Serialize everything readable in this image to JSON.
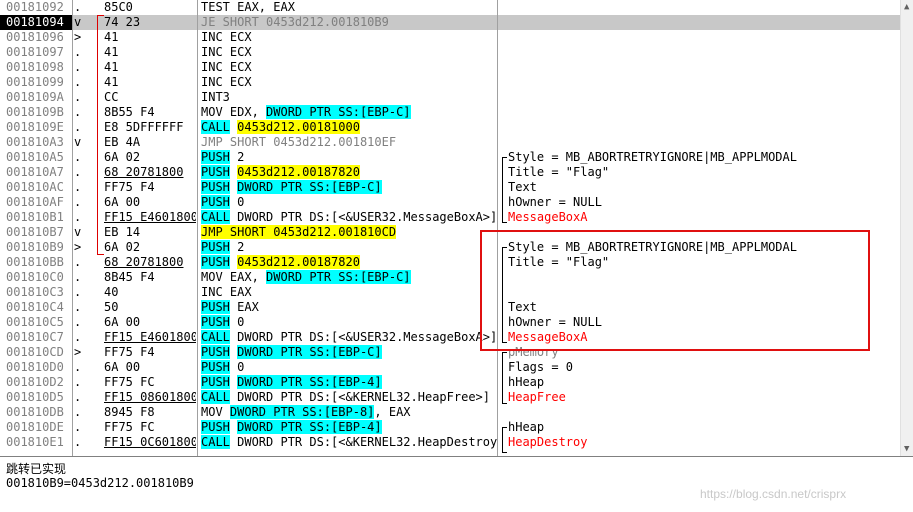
{
  "rows": [
    {
      "addr": "00181092",
      "mk": ".",
      "hex": "85C0",
      "dis": [
        {
          "t": "TEST EAX, EAX"
        }
      ],
      "cmt": []
    },
    {
      "addr": "00181094",
      "mk": "v",
      "hex": "74 23",
      "dis": [
        {
          "t": "JE SHORT 0453d212.001810B9",
          "c": "gray"
        }
      ],
      "cmt": [],
      "state": "cur"
    },
    {
      "addr": "00181096",
      "mk": ">",
      "hex": "41",
      "dis": [
        {
          "t": "INC ECX"
        }
      ],
      "cmt": []
    },
    {
      "addr": "00181097",
      "mk": ".",
      "hex": "41",
      "dis": [
        {
          "t": "INC ECX"
        }
      ],
      "cmt": []
    },
    {
      "addr": "00181098",
      "mk": ".",
      "hex": "41",
      "dis": [
        {
          "t": "INC ECX"
        }
      ],
      "cmt": []
    },
    {
      "addr": "00181099",
      "mk": ".",
      "hex": "41",
      "dis": [
        {
          "t": "INC ECX"
        }
      ],
      "cmt": []
    },
    {
      "addr": "0018109A",
      "mk": ".",
      "hex": "CC",
      "dis": [
        {
          "t": "INT3"
        }
      ],
      "cmt": []
    },
    {
      "addr": "0018109B",
      "mk": ".",
      "hex": "8B55 F4",
      "dis": [
        {
          "t": "MOV EDX, "
        },
        {
          "t": "DWORD PTR SS:[EBP-C]",
          "c": "cy"
        }
      ],
      "cmt": []
    },
    {
      "addr": "0018109E",
      "mk": ".",
      "hex": "E8 5DFFFFFF",
      "dis": [
        {
          "t": "CALL",
          "c": "cy"
        },
        {
          "t": " "
        },
        {
          "t": "0453d212.00181000",
          "c": "yl"
        }
      ],
      "cmt": []
    },
    {
      "addr": "001810A3",
      "mk": "v",
      "hex": "EB 4A",
      "dis": [
        {
          "t": "JMP SHORT 0453d212.001810EF",
          "c": "gray"
        }
      ],
      "cmt": []
    },
    {
      "addr": "001810A5",
      "mk": ".",
      "hex": "6A 02",
      "dis": [
        {
          "t": "PUSH",
          "c": "cy"
        },
        {
          "t": " 2"
        }
      ],
      "cmt": [
        {
          "t": "Style = MB_ABORTRETRYIGNORE|MB_APPLMODAL"
        }
      ]
    },
    {
      "addr": "001810A7",
      "mk": ".",
      "hex": "68 20781800",
      "hexul": true,
      "dis": [
        {
          "t": "PUSH",
          "c": "cy"
        },
        {
          "t": " "
        },
        {
          "t": "0453d212.00187820",
          "c": "yl"
        }
      ],
      "cmt": [
        {
          "t": "Title = \"Flag\""
        }
      ]
    },
    {
      "addr": "001810AC",
      "mk": ".",
      "hex": "FF75 F4",
      "dis": [
        {
          "t": "PUSH",
          "c": "cy"
        },
        {
          "t": " "
        },
        {
          "t": "DWORD PTR SS:[EBP-C]",
          "c": "cy"
        }
      ],
      "cmt": [
        {
          "t": "Text"
        }
      ]
    },
    {
      "addr": "001810AF",
      "mk": ".",
      "hex": "6A 00",
      "dis": [
        {
          "t": "PUSH",
          "c": "cy"
        },
        {
          "t": " 0"
        }
      ],
      "cmt": [
        {
          "t": "hOwner = NULL"
        }
      ]
    },
    {
      "addr": "001810B1",
      "mk": ".",
      "hex": "FF15 E4601800",
      "hexul": true,
      "dis": [
        {
          "t": "CALL",
          "c": "cy"
        },
        {
          "t": " DWORD PTR DS:[<&USER32.MessageBoxA>]"
        }
      ],
      "cmt": [
        {
          "t": "MessageBoxA",
          "c": "red"
        }
      ]
    },
    {
      "addr": "001810B7",
      "mk": "v",
      "hex": "EB 14",
      "dis": [
        {
          "t": "JMP SHORT 0453d212.001810CD",
          "c": "yl"
        }
      ],
      "cmt": []
    },
    {
      "addr": "001810B9",
      "mk": ">",
      "hex": "6A 02",
      "dis": [
        {
          "t": "PUSH",
          "c": "cy"
        },
        {
          "t": " 2"
        }
      ],
      "cmt": [
        {
          "t": "Style = MB_ABORTRETRYIGNORE|MB_APPLMODAL"
        }
      ]
    },
    {
      "addr": "001810BB",
      "mk": ".",
      "hex": "68 20781800",
      "hexul": true,
      "dis": [
        {
          "t": "PUSH",
          "c": "cy"
        },
        {
          "t": " "
        },
        {
          "t": "0453d212.00187820",
          "c": "yl"
        }
      ],
      "cmt": [
        {
          "t": "Title = \"Flag\""
        }
      ]
    },
    {
      "addr": "001810C0",
      "mk": ".",
      "hex": "8B45 F4",
      "dis": [
        {
          "t": "MOV EAX, "
        },
        {
          "t": "DWORD PTR SS:[EBP-C]",
          "c": "cy"
        }
      ],
      "cmt": []
    },
    {
      "addr": "001810C3",
      "mk": ".",
      "hex": "40",
      "dis": [
        {
          "t": "INC EAX"
        }
      ],
      "cmt": []
    },
    {
      "addr": "001810C4",
      "mk": ".",
      "hex": "50",
      "dis": [
        {
          "t": "PUSH",
          "c": "cy"
        },
        {
          "t": " EAX"
        }
      ],
      "cmt": [
        {
          "t": "Text"
        }
      ]
    },
    {
      "addr": "001810C5",
      "mk": ".",
      "hex": "6A 00",
      "dis": [
        {
          "t": "PUSH",
          "c": "cy"
        },
        {
          "t": " 0"
        }
      ],
      "cmt": [
        {
          "t": "hOwner = NULL"
        }
      ]
    },
    {
      "addr": "001810C7",
      "mk": ".",
      "hex": "FF15 E4601800",
      "hexul": true,
      "dis": [
        {
          "t": "CALL",
          "c": "cy"
        },
        {
          "t": " DWORD PTR DS:[<&USER32.MessageBoxA>]"
        }
      ],
      "cmt": [
        {
          "t": "MessageBoxA",
          "c": "red"
        }
      ]
    },
    {
      "addr": "001810CD",
      "mk": ">",
      "hex": "FF75 F4",
      "dis": [
        {
          "t": "PUSH",
          "c": "cy"
        },
        {
          "t": " "
        },
        {
          "t": "DWORD PTR SS:[EBP-C]",
          "c": "cy"
        }
      ],
      "cmt": [
        {
          "t": "pMemory",
          "c": "gray"
        }
      ]
    },
    {
      "addr": "001810D0",
      "mk": ".",
      "hex": "6A 00",
      "dis": [
        {
          "t": "PUSH",
          "c": "cy"
        },
        {
          "t": " 0"
        }
      ],
      "cmt": [
        {
          "t": "Flags = 0"
        }
      ]
    },
    {
      "addr": "001810D2",
      "mk": ".",
      "hex": "FF75 FC",
      "dis": [
        {
          "t": "PUSH",
          "c": "cy"
        },
        {
          "t": " "
        },
        {
          "t": "DWORD PTR SS:[EBP-4]",
          "c": "cy"
        }
      ],
      "cmt": [
        {
          "t": "hHeap"
        }
      ]
    },
    {
      "addr": "001810D5",
      "mk": ".",
      "hex": "FF15 08601800",
      "hexul": true,
      "dis": [
        {
          "t": "CALL",
          "c": "cy"
        },
        {
          "t": " DWORD PTR DS:[<&KERNEL32.HeapFree>]"
        }
      ],
      "cmt": [
        {
          "t": "HeapFree",
          "c": "red"
        }
      ]
    },
    {
      "addr": "001810DB",
      "mk": ".",
      "hex": "8945 F8",
      "dis": [
        {
          "t": "MOV "
        },
        {
          "t": "DWORD PTR SS:[EBP-8]",
          "c": "cy"
        },
        {
          "t": ", EAX"
        }
      ],
      "cmt": []
    },
    {
      "addr": "001810DE",
      "mk": ".",
      "hex": "FF75 FC",
      "dis": [
        {
          "t": "PUSH",
          "c": "cy"
        },
        {
          "t": " "
        },
        {
          "t": "DWORD PTR SS:[EBP-4]",
          "c": "cy"
        }
      ],
      "cmt": [
        {
          "t": "hHeap"
        }
      ]
    },
    {
      "addr": "001810E1",
      "mk": ".",
      "hex": "FF15 0C601800",
      "hexul": true,
      "dis": [
        {
          "t": "CALL",
          "c": "cy"
        },
        {
          "t": " DWORD PTR DS:[<&KERNEL32.HeapDestroy>]"
        }
      ],
      "cmt": [
        {
          "t": "HeapDestroy",
          "c": "red"
        }
      ]
    }
  ],
  "info": {
    "line1": "跳转已实现",
    "line2": "001810B9=0453d212.001810B9"
  },
  "watermark": "https://blog.csdn.net/crisprx",
  "colors": {
    "cyan": "#00ffff",
    "yellow": "#ffff00",
    "red": "#ff0000",
    "highlight_box": "#e01010"
  }
}
